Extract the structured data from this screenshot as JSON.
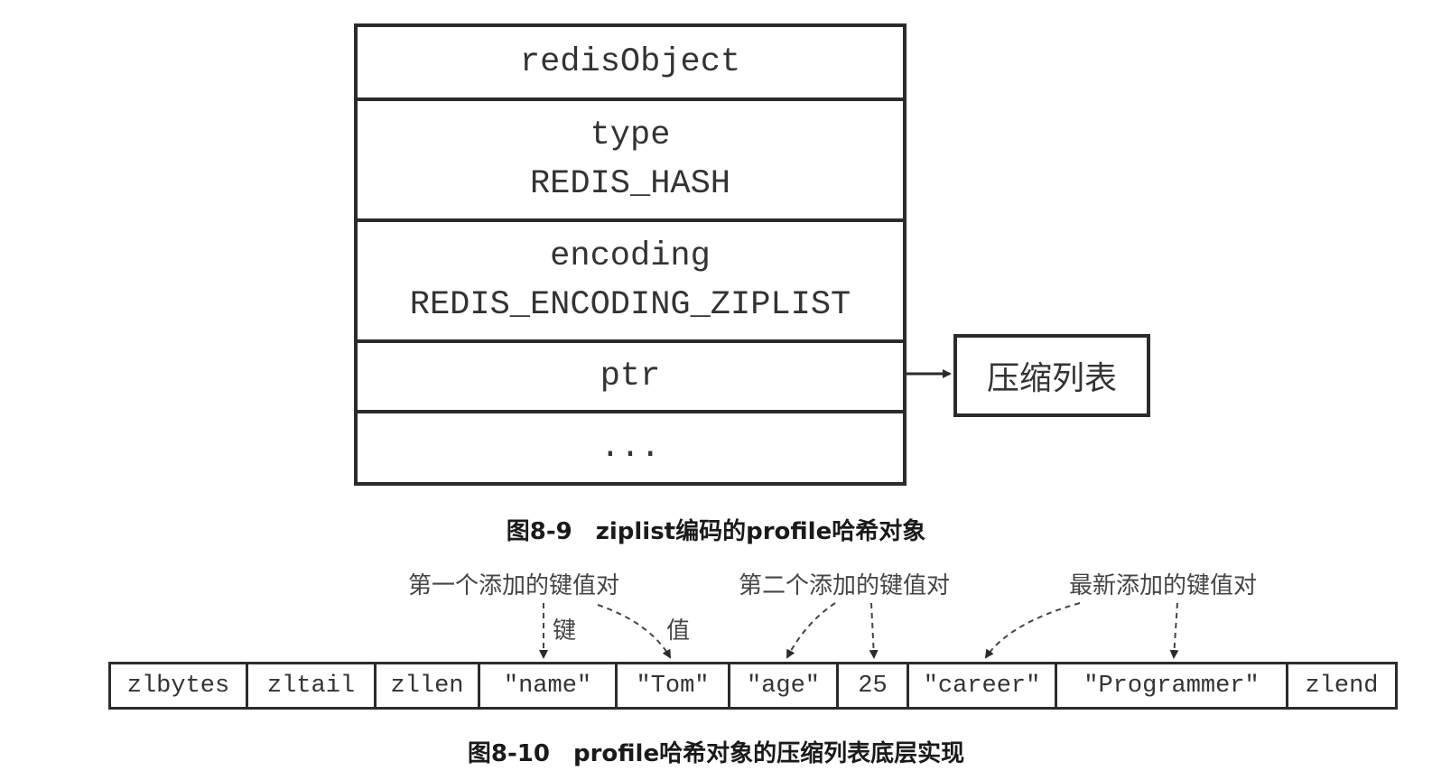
{
  "redis_object": {
    "header": "redisObject",
    "type_label": "type",
    "type_value": "REDIS_HASH",
    "encoding_label": "encoding",
    "encoding_value": "REDIS_ENCODING_ZIPLIST",
    "ptr_label": "ptr",
    "more_label": "..."
  },
  "ptr_target": "压缩列表",
  "caption_top": "图8-9　ziplist编码的profile哈希对象",
  "ziplist_cells": [
    "zlbytes",
    "zltail",
    "zllen",
    "\"name\"",
    "\"Tom\"",
    "\"age\"",
    "25",
    "\"career\"",
    "\"Programmer\"",
    "zlend"
  ],
  "annotations": {
    "first_pair": "第一个添加的键值对",
    "second_pair": "第二个添加的键值对",
    "newest_pair": "最新添加的键值对",
    "key_label": "键",
    "value_label": "值"
  },
  "caption_bottom": "图8-10　profile哈希对象的压缩列表底层实现"
}
